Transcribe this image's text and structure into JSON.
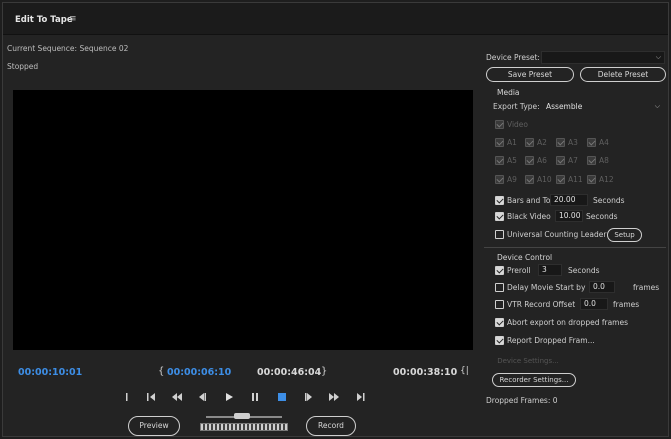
{
  "panel": {
    "title": "Edit To Tape",
    "menu_icon": "hamburger-menu-icon"
  },
  "sequence_label": "Current Sequence: Sequence 02",
  "status": "Stopped",
  "timecodes": {
    "current": "00:00:10:01",
    "in_point": "00:00:06:10",
    "out_point": "00:00:46:04",
    "duration": "00:00:38:10",
    "open_bracket": "{",
    "close_bracket": "}"
  },
  "transport_icons": [
    "mark-in-icon",
    "go-to-in-icon",
    "rewind-icon",
    "step-back-icon",
    "play-icon",
    "pause-icon",
    "stop-icon",
    "step-forward-icon",
    "fast-forward-icon",
    "go-to-out-icon"
  ],
  "buttons": {
    "preview": "Preview",
    "record": "Record"
  },
  "device_preset": {
    "label": "Device Preset:",
    "value": "",
    "save": "Save Preset",
    "delete": "Delete Preset"
  },
  "media": {
    "heading": "Media",
    "export_type_label": "Export Type:",
    "export_type_value": "Assemble",
    "video_label": "Video",
    "audio_channels": [
      [
        "A1",
        "A2",
        "A3",
        "A4"
      ],
      [
        "A5",
        "A6",
        "A7",
        "A8"
      ],
      [
        "A9",
        "A10",
        "A11",
        "A12"
      ]
    ],
    "bars_and_tone": {
      "label": "Bars and Tone",
      "value": "20.00",
      "unit": "Seconds"
    },
    "black_video": {
      "label": "Black Video",
      "value": "10.00",
      "unit": "Seconds"
    },
    "universal_counting_leader": {
      "label": "Universal Counting Leader",
      "setup": "Setup"
    }
  },
  "device_control": {
    "heading": "Device Control",
    "preroll": {
      "label": "Preroll",
      "value": "3",
      "unit": "Seconds"
    },
    "delay_movie_start": {
      "label": "Delay Movie Start by",
      "value": "0.0",
      "unit": "frames"
    },
    "vtr_record_offset": {
      "label": "VTR Record Offset",
      "value": "0.0",
      "unit": "frames"
    },
    "abort_on_dropped": "Abort export on dropped frames",
    "report_dropped": "Report Dropped Fram...",
    "device_settings": "Device Settings...",
    "recorder_settings": "Recorder Settings...",
    "dropped_frames": "Dropped Frames: 0"
  },
  "colors": {
    "timecode_blue": "#3d8ee6",
    "background": "#232323",
    "video": "#000000"
  }
}
